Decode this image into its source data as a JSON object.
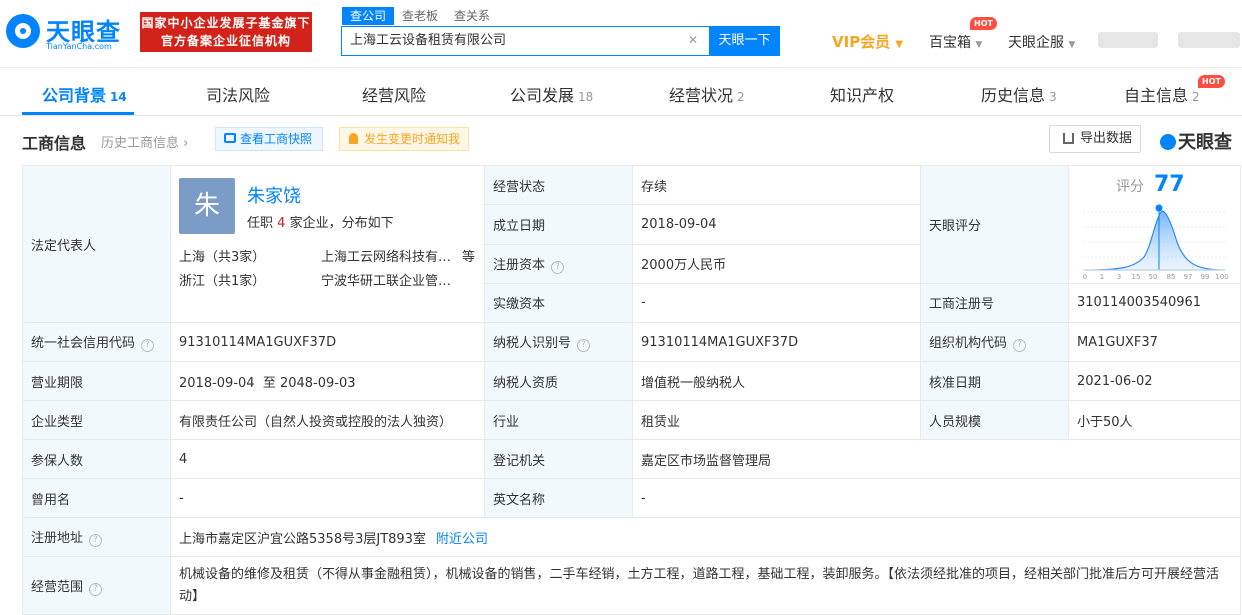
{
  "header": {
    "logo_name": "天眼查",
    "logo_domain": "TianYanCha.com",
    "badge_line1": "国家中小企业发展子基金旗下",
    "badge_line2": "官方备案企业征信机构",
    "search_tabs": [
      "查公司",
      "查老板",
      "查关系"
    ],
    "search_value": "上海工云设备租赁有限公司",
    "search_button": "天眼一下",
    "vip": "VIP会员",
    "box": "百宝箱",
    "enterprise": "天眼企服",
    "hot": "HOT"
  },
  "subnav": [
    {
      "label": "公司背景",
      "count": "14"
    },
    {
      "label": "司法风险",
      "count": ""
    },
    {
      "label": "经营风险",
      "count": ""
    },
    {
      "label": "公司发展",
      "count": "18"
    },
    {
      "label": "经营状况",
      "count": "2"
    },
    {
      "label": "知识产权",
      "count": ""
    },
    {
      "label": "历史信息",
      "count": "3"
    },
    {
      "label": "自主信息",
      "count": "2"
    }
  ],
  "section": {
    "title": "工商信息",
    "history_link": "历史工商信息",
    "snapshot_button": "查看工商快照",
    "notify_button": "发生变更时通知我",
    "export_button": "导出数据",
    "brand": "天眼查"
  },
  "rep": {
    "label": "法定代表人",
    "avatar_char": "朱",
    "name": "朱家饶",
    "summary_prefix": "任职",
    "summary_count": "4",
    "summary_suffix": "家企业，分布如下",
    "row1_region": "上海（共3家）",
    "row1_company": "上海工云网络科技有限公司",
    "row1_more": "等",
    "row2_region": "浙江（共1家）",
    "row2_company": "宁波华研工联企业管理合伙企业"
  },
  "score": {
    "label": "天眼评分",
    "score_label": "评分",
    "value": "77",
    "axis": [
      "0",
      "1",
      "3",
      "15",
      "50",
      "85",
      "97",
      "99",
      "100"
    ]
  },
  "fields": {
    "status_label": "经营状态",
    "status": "存续",
    "found_label": "成立日期",
    "found": "2018-09-04",
    "reg_cap_label": "注册资本",
    "reg_cap": "2000万人民币",
    "paid_cap_label": "实缴资本",
    "paid_cap": "-",
    "reg_no_label": "工商注册号",
    "reg_no": "310114003540961",
    "credit_label": "统一社会信用代码",
    "credit": "91310114MA1GUXF37D",
    "tax_label": "纳税人识别号",
    "tax": "91310114MA1GUXF37D",
    "org_label": "组织机构代码",
    "org": "MA1GUXF37",
    "term_label": "营业期限",
    "term": "2018-09-04  至 2048-09-03",
    "tax_qual_label": "纳税人资质",
    "tax_qual": "增值税一般纳税人",
    "approve_label": "核准日期",
    "approve": "2021-06-02",
    "type_label": "企业类型",
    "type": "有限责任公司（自然人投资或控股的法人独资）",
    "industry_label": "行业",
    "industry": "租赁业",
    "staff_label": "人员规模",
    "staff": "小于50人",
    "insured_label": "参保人数",
    "insured": "4",
    "authority_label": "登记机关",
    "authority": "嘉定区市场监督管理局",
    "former_label": "曾用名",
    "former": "-",
    "english_label": "英文名称",
    "english": "-",
    "address_label": "注册地址",
    "address": "上海市嘉定区沪宜公路5358号3层JT893室",
    "nearby": "附近公司",
    "scope_label": "经营范围",
    "scope": "机械设备的维修及租赁（不得从事金融租赁），机械设备的销售，二手车经销，土方工程，道路工程，基础工程，装卸服务。【依法须经批准的项目，经相关部门批准后方可开展经营活动】"
  }
}
